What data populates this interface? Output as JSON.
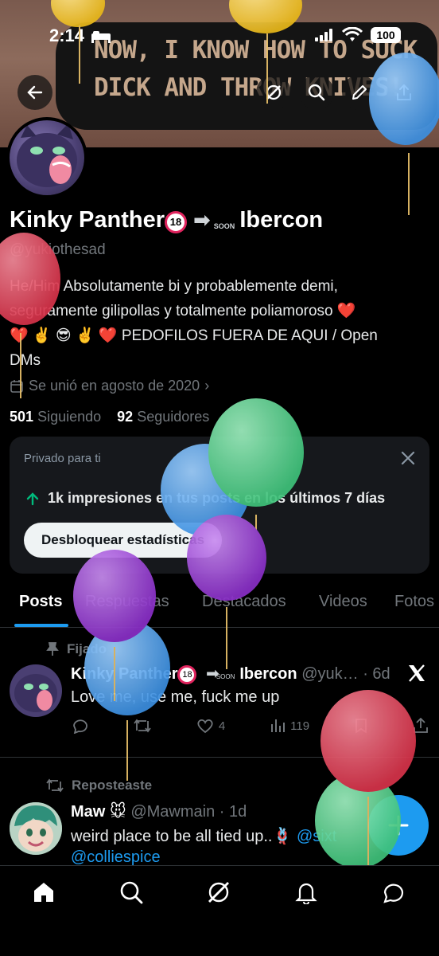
{
  "status": {
    "time": "2:14",
    "battery": "100"
  },
  "banner": {
    "caption_line1": "NOW, I KNOW HOW TO SUCK",
    "caption_line2": "DICK AND THROW KNIVES!"
  },
  "profile": {
    "name": "Kinky Panther",
    "age_badge": "18",
    "soon_label": "SOON",
    "event": "Ibercon",
    "handle": "@yukiothesad",
    "bio_line1": "He/Him Absolutamente bi y probablemente demi,",
    "bio_line2": "seguramente gilipollas y totalmente poliamoroso ❤️",
    "bio_line3": "❤️ ✌️ 😎 ✌️  ❤️ PEDOFILOS FUERA DE AQUI / Open",
    "bio_line4": "DMs",
    "joined": "Se unió en agosto de 2020",
    "following_count": "501",
    "following_label": "Siguiendo",
    "followers_count": "92",
    "followers_label": "Seguidores"
  },
  "analytics": {
    "private_label": "Privado para ti",
    "impressions_text": "1k impresiones en tus posts en los últimos 7 días",
    "unlock_button": "Desbloquear estadísticas"
  },
  "tabs": [
    "Posts",
    "Respuestas",
    "Destacados",
    "Videos",
    "Fotos"
  ],
  "posts": [
    {
      "context": "Fijado",
      "name": "Kinky Panther",
      "age_badge": "18",
      "soon_label": "SOON",
      "event": "Ibercon",
      "handle": "@yuk…",
      "time": "· 6d",
      "text": "Love me, use me, fuck me up",
      "likes": "4",
      "views": "119"
    },
    {
      "context": "Reposteaste",
      "name": "Maw 🐭",
      "handle": "@Mawmain",
      "time": "· 1d",
      "text": "weird place to be all tied up..🪢",
      "mention_inline": "@sixt",
      "mention_line2": "@colliespice"
    }
  ],
  "colors": {
    "accent": "#1d9bf0",
    "background": "#000000",
    "card": "#16181c",
    "muted": "#71767b"
  },
  "icons": [
    "back-icon",
    "grok-icon",
    "search-icon",
    "edit-icon",
    "share-icon",
    "calendar-icon",
    "close-icon",
    "arrow-up-icon",
    "pin-icon",
    "repost-icon",
    "reply-icon",
    "like-icon",
    "views-icon",
    "bookmark-icon",
    "x-logo-icon",
    "plus-icon",
    "home-icon",
    "notifications-icon",
    "messages-icon"
  ]
}
